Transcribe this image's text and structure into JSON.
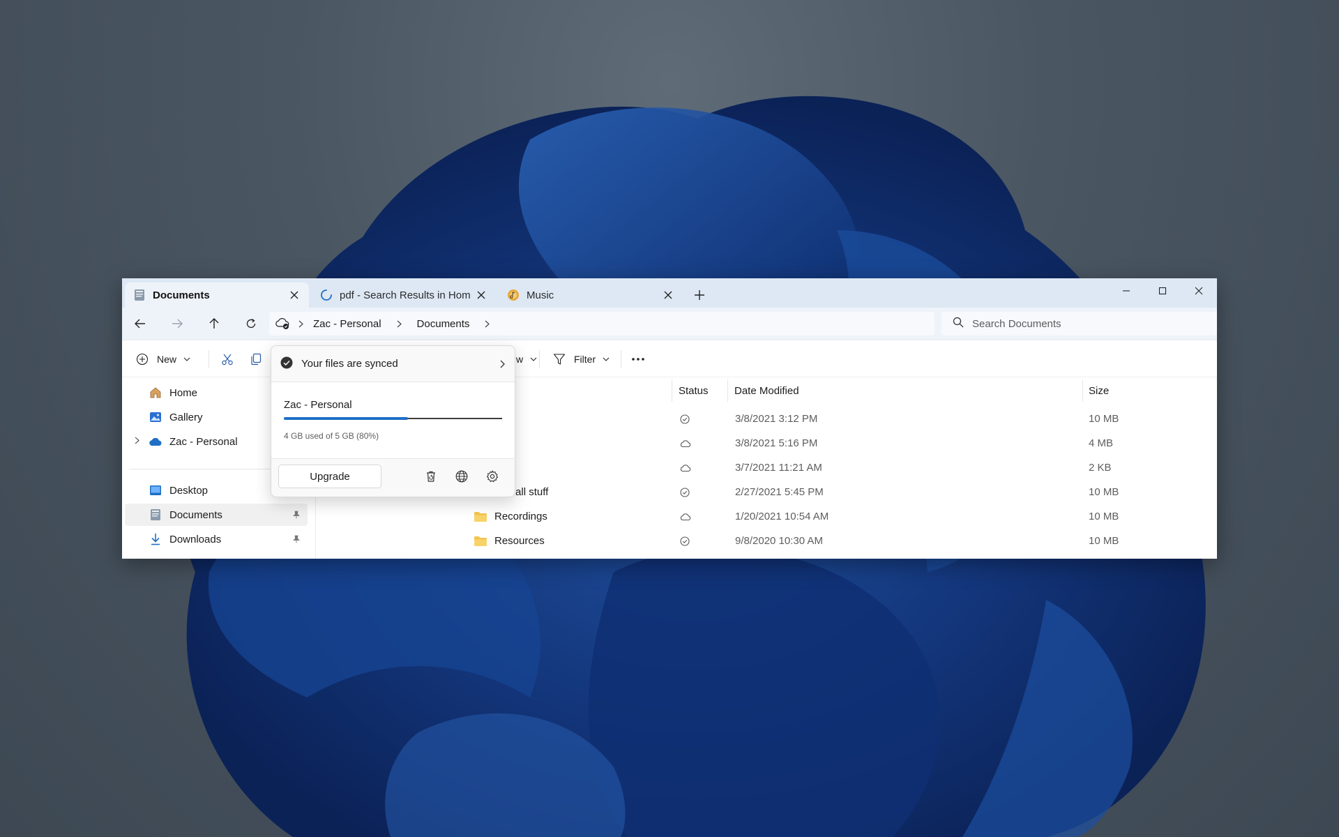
{
  "tabs": [
    {
      "label": "Documents",
      "icon": "documents-icon",
      "active": true
    },
    {
      "label": "pdf - Search Results in Hom",
      "icon": "loading-spinner-icon",
      "active": false
    },
    {
      "label": "Music",
      "icon": "music-icon",
      "active": false
    }
  ],
  "address_bar": {
    "crumbs": [
      "Zac - Personal",
      "Documents"
    ]
  },
  "search": {
    "placeholder": "Search Documents"
  },
  "command_bar": {
    "new_label": "New",
    "view_label_partial": "w",
    "filter_label": "Filter"
  },
  "sidebar": {
    "items": [
      {
        "label": "Home",
        "icon": "home-icon"
      },
      {
        "label": "Gallery",
        "icon": "gallery-icon"
      },
      {
        "label": "Zac - Personal",
        "icon": "onedrive-cloud-icon"
      },
      {
        "label": "Desktop",
        "icon": "desktop-icon"
      },
      {
        "label": "Documents",
        "icon": "documents-icon"
      },
      {
        "label": "Downloads",
        "icon": "downloads-icon"
      }
    ]
  },
  "columns": {
    "status": "Status",
    "date": "Date Modified",
    "size": "Size"
  },
  "files": [
    {
      "name": "",
      "status": "synced",
      "date": "3/8/2021 3:12 PM",
      "size": "10 MB"
    },
    {
      "name": "",
      "status": "cloud",
      "date": "3/8/2021 5:16 PM",
      "size": "4 MB"
    },
    {
      "name": "",
      "status": "cloud",
      "date": "3/7/2021 11:21 AM",
      "size": "2 KB"
    },
    {
      "name": "Pinball stuff",
      "status": "synced",
      "date": "2/27/2021 5:45 PM",
      "size": "10 MB"
    },
    {
      "name": "Recordings",
      "status": "cloud",
      "date": "1/20/2021 10:54 AM",
      "size": "10 MB"
    },
    {
      "name": "Resources",
      "status": "synced",
      "date": "9/8/2020 10:30 AM",
      "size": "10 MB"
    }
  ],
  "flyout": {
    "title": "Your files are synced",
    "account": "Zac - Personal",
    "usage_text": "4 GB used of 5 GB (80%)",
    "usage_fraction": 0.57,
    "upgrade_label": "Upgrade"
  },
  "colors": {
    "accent": "#1f6fc5",
    "tabbar": "#dde8f4",
    "folder": "#f4c44e"
  }
}
